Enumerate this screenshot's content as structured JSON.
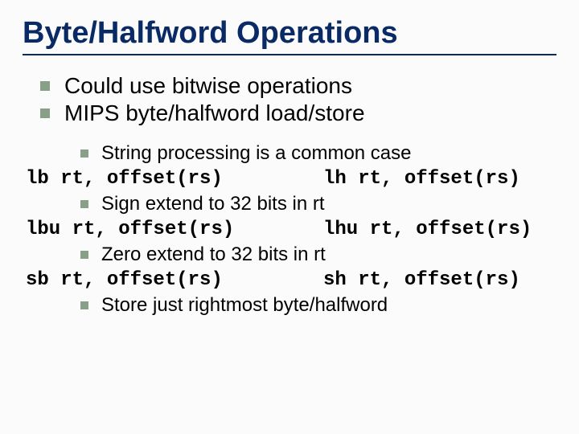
{
  "title": "Byte/Halfword Operations",
  "bullets": {
    "b1": "Could use bitwise operations",
    "b2": "MIPS byte/halfword load/store",
    "b3": "String processing is a common case",
    "b4": "Sign extend to 32 bits in rt",
    "b5": "Zero extend to 32 bits in rt",
    "b6": "Store just rightmost byte/halfword"
  },
  "code": {
    "r1l": "lb rt, offset(rs)",
    "r1r": "lh rt, offset(rs)",
    "r2l": "lbu rt, offset(rs)",
    "r2r": "lhu rt, offset(rs)",
    "r3l": "sb rt, offset(rs)",
    "r3r": "sh rt, offset(rs)"
  }
}
